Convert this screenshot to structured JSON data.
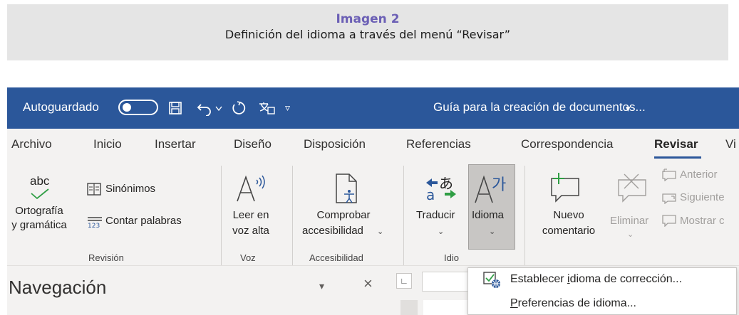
{
  "caption": {
    "label": "Imagen 2",
    "title": "Definición del idioma a través del menú “Revisar”"
  },
  "titlebar": {
    "autosave_label": "Autoguardado",
    "doc_title": "Guía para la creación de documentos...",
    "doc_title_caret": "▾",
    "qat_more": "▿"
  },
  "tabs": [
    {
      "label": "Archivo"
    },
    {
      "label": "Inicio"
    },
    {
      "label": "Insertar"
    },
    {
      "label": "Diseño"
    },
    {
      "label": "Disposición"
    },
    {
      "label": "Referencias"
    },
    {
      "label": "Correspondencia"
    },
    {
      "label": "Revisar"
    },
    {
      "label": "Vi"
    }
  ],
  "ribbon": {
    "spelling_icon_text": "abc",
    "spelling_label_1": "Ortografía",
    "spelling_label_2": "y gramática",
    "thesaurus_label": "Sinónimos",
    "word_count_label": "Contar palabras",
    "read_aloud_1": "Leer en",
    "read_aloud_2": "voz alta",
    "accessibility_1": "Comprobar",
    "accessibility_2": "accesibilidad",
    "translate_label": "Traducir",
    "language_label": "Idioma",
    "new_comment_1": "Nuevo",
    "new_comment_2": "comentario",
    "delete_label": "Eliminar",
    "previous_label": "Anterior",
    "next_label": "Siguiente",
    "show_label": "Mostrar c",
    "groups": {
      "revision": "Revisión",
      "voice": "Voz",
      "accessibility": "Accesibilidad",
      "language": "Idio"
    }
  },
  "navigation": {
    "title": "Navegación",
    "close": "×",
    "chevron": "▾"
  },
  "dropdown": {
    "item1_before": "Establecer ",
    "item1_u": "i",
    "item1_after": "dioma de corrección...",
    "item2_u": "P",
    "item2_after": "referencias de idioma..."
  },
  "colors": {
    "titlebar": "#2b579a",
    "caption_label": "#6b5fb5",
    "ribbon_bg": "#f3f2f1"
  }
}
